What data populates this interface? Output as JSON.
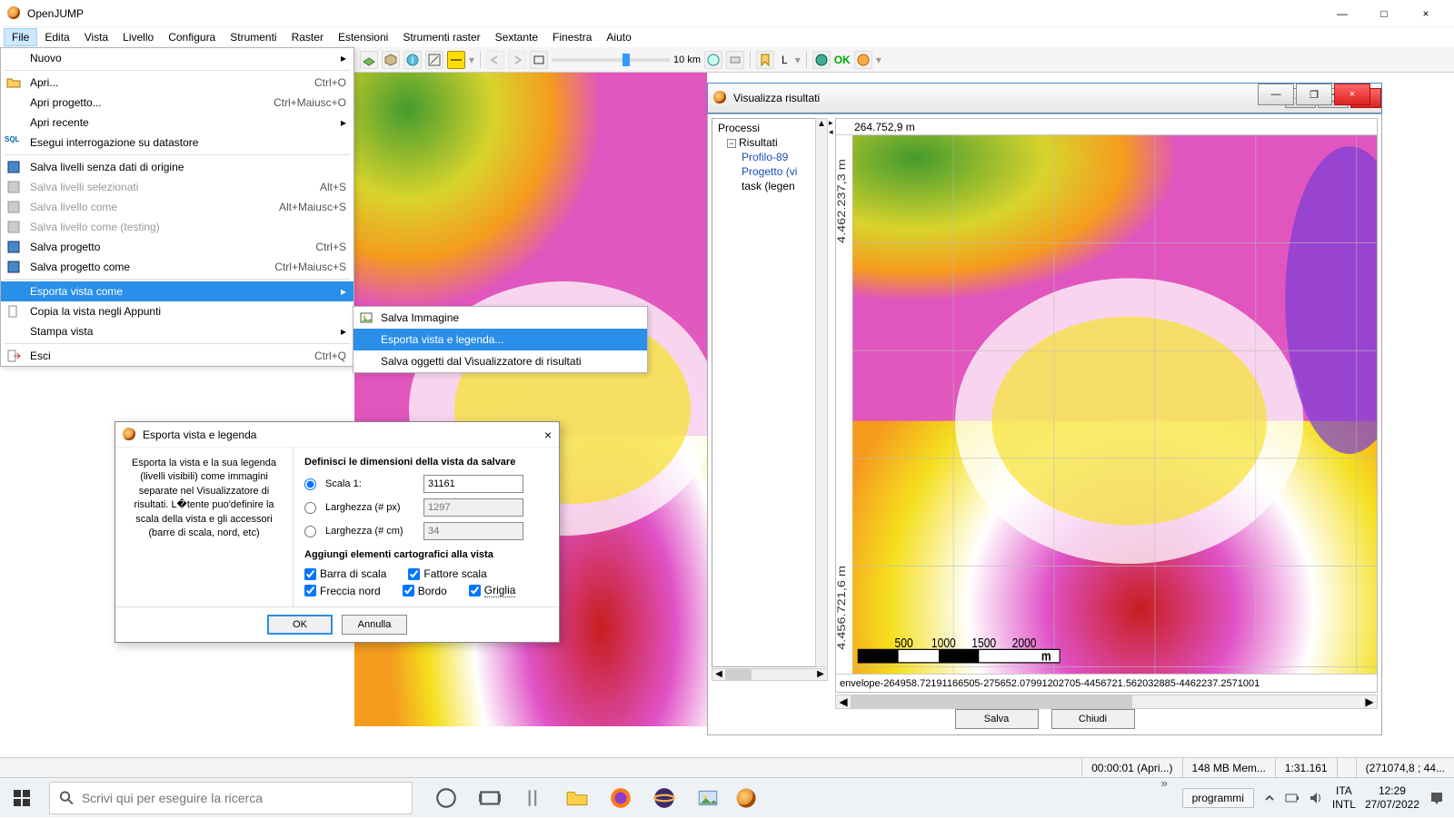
{
  "app": {
    "title": "OpenJUMP"
  },
  "win_buttons": {
    "min": "—",
    "max": "□",
    "close": "×"
  },
  "menubar": [
    "File",
    "Edita",
    "Vista",
    "Livello",
    "Configura",
    "Strumenti",
    "Raster",
    "Estensioni",
    "Strumenti raster",
    "Sextante",
    "Finestra",
    "Aiuto"
  ],
  "toolbar": {
    "scale_label": "10 km",
    "zoom_label": "L",
    "ok": "OK"
  },
  "file_menu": {
    "groups": [
      [
        {
          "label": "Nuovo",
          "shortcut": "",
          "arrow": true
        }
      ],
      [
        {
          "label": "Apri...",
          "shortcut": "Ctrl+O",
          "icon": "folder"
        },
        {
          "label": "Apri progetto...",
          "shortcut": "Ctrl+Maiusc+O"
        },
        {
          "label": "Apri recente",
          "arrow": true
        },
        {
          "label": "Esegui interrogazione su datastore",
          "icon": "sql"
        }
      ],
      [
        {
          "label": "Salva livelli senza dati di origine",
          "icon": "disk"
        },
        {
          "label": "Salva livelli selezionati",
          "shortcut": "Alt+S",
          "disabled": true,
          "icon": "disk"
        },
        {
          "label": "Salva livello come",
          "shortcut": "Alt+Maiusc+S",
          "disabled": true,
          "icon": "disk"
        },
        {
          "label": "Salva livello come (testing)",
          "disabled": true,
          "icon": "disk"
        },
        {
          "label": "Salva progetto",
          "shortcut": "Ctrl+S",
          "icon": "disk"
        },
        {
          "label": "Salva progetto come",
          "shortcut": "Ctrl+Maiusc+S",
          "icon": "disk"
        }
      ],
      [
        {
          "label": "Esporta vista come",
          "arrow": true,
          "highlight": true
        },
        {
          "label": "Copia la vista negli Appunti",
          "icon": "clip"
        },
        {
          "label": "Stampa vista",
          "arrow": true
        }
      ],
      [
        {
          "label": "Esci",
          "shortcut": "Ctrl+Q",
          "icon": "exit"
        }
      ]
    ]
  },
  "submenu": [
    {
      "label": "Salva Immagine",
      "icon": "image"
    },
    {
      "label": "Esporta vista e legenda...",
      "highlight": true
    },
    {
      "label": "Salva oggetti dal Visualizzatore di risultati"
    }
  ],
  "dialog": {
    "title": "Esporta vista e legenda",
    "help_text": "Esporta la vista e la sua legenda (livelli visibili) come immagini separate nel Visualizzatore di risultati. L�tente puo'definire la scala della vista e gli accessori (barre di scala, nord, etc)",
    "section1": "Definisci le dimensioni della vista da salvare",
    "rows": {
      "scala_label": "Scala 1:",
      "scala_value": "31161",
      "larghezza_px_label": "Larghezza (# px)",
      "larghezza_px_value": "1297",
      "larghezza_cm_label": "Larghezza (# cm)",
      "larghezza_cm_value": "34"
    },
    "section2": "Aggiungi elementi cartografici alla vista",
    "checks": {
      "barra_di_scala": "Barra di scala",
      "fattore_scala": "Fattore scala",
      "freccia_nord": "Freccia nord",
      "bordo": "Bordo",
      "griglia": "Griglia"
    },
    "ok": "OK",
    "cancel": "Annulla"
  },
  "results_window": {
    "title": "Visualizza risultati",
    "tree": {
      "root": "Processi",
      "child1": "Risultati",
      "leaf1": "Profilo-89",
      "leaf2": "Progetto (vi",
      "leaf3": "task (legen"
    },
    "coord": "264.752,9 m",
    "left_axis_top": "4.462.237,3 m",
    "left_axis_bot": "4.456.721,6 m",
    "scalebar_labels": [
      "500",
      "1000",
      "1500",
      "2000",
      "m"
    ],
    "envelope": "envelope-264958.72191166505-275652.07991202705-4456721.562032885-4462237.2571001",
    "save": "Salva",
    "close": "Chiudi"
  },
  "status": {
    "time": "00:00:01 (Apri...)",
    "mem": "148 MB Mem...",
    "scale": "1:31.161",
    "coords": "(271074,8 ; 44..."
  },
  "taskbar": {
    "search_placeholder": "Scrivi qui per eseguire la ricerca",
    "pill": "programmi",
    "lang1": "ITA",
    "lang2": "INTL",
    "time": "12:29",
    "date": "27/07/2022"
  }
}
